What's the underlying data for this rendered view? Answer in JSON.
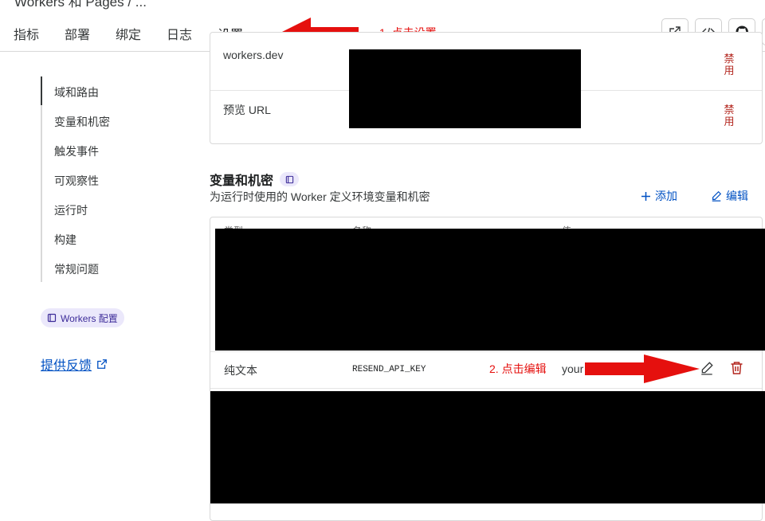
{
  "breadcrumb": "Workers 和 Pages / ...",
  "tabs": [
    {
      "label": "指标"
    },
    {
      "label": "部署"
    },
    {
      "label": "绑定"
    },
    {
      "label": "日志"
    },
    {
      "label": "设置",
      "active": true
    }
  ],
  "toolbar_icons": [
    "external-link-icon",
    "code-icon",
    "github-icon"
  ],
  "sidebar": {
    "items": [
      {
        "label": "域和路由",
        "active": true
      },
      {
        "label": "变量和机密"
      },
      {
        "label": "触发事件"
      },
      {
        "label": "可观察性"
      },
      {
        "label": "运行时"
      },
      {
        "label": "构建"
      },
      {
        "label": "常规问题"
      }
    ],
    "docs_pill": "Workers 配置",
    "feedback_link": "提供反馈"
  },
  "domains": {
    "rows": [
      {
        "label": "workers.dev",
        "action": "禁用"
      },
      {
        "label": "预览 URL",
        "action": "禁用"
      }
    ]
  },
  "variables": {
    "title": "变量和机密",
    "description": "为运行时使用的 Worker 定义环境变量和机密",
    "add_label": "添加",
    "edit_label": "编辑",
    "columns": [
      "类型",
      "名称",
      "值"
    ],
    "row": {
      "type": "纯文本",
      "name": "RESEND_API_KEY",
      "value": "your"
    }
  },
  "annotations": {
    "step1": "1. 点击设置",
    "step2": "2. 点击编辑"
  },
  "colors": {
    "accent": "#0051c3",
    "danger": "#b3261e",
    "annotation_red": "#e5100e",
    "pill_bg": "#ebe8fb"
  }
}
